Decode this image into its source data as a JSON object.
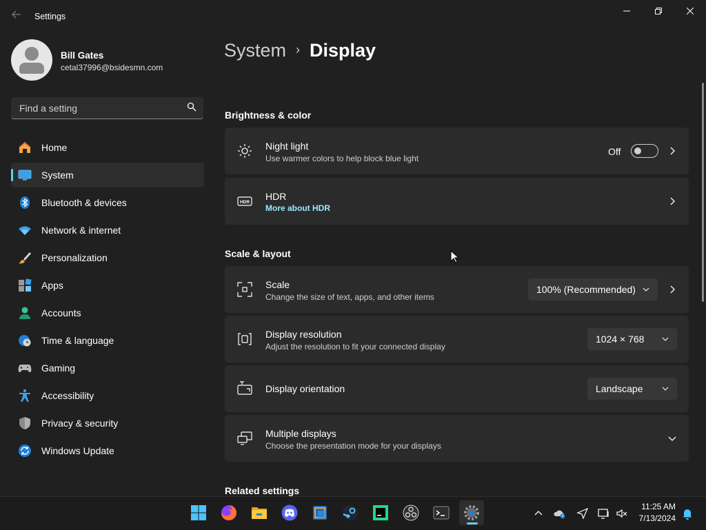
{
  "window": {
    "title": "Settings",
    "minimize": "—",
    "maximize": "❐",
    "close": "✕"
  },
  "user": {
    "name": "Bill Gates",
    "email": "cetal37996@bsidesmn.com"
  },
  "search": {
    "placeholder": "Find a setting"
  },
  "nav": [
    {
      "label": "Home",
      "icon": "home-icon"
    },
    {
      "label": "System",
      "icon": "monitor-icon",
      "active": true
    },
    {
      "label": "Bluetooth & devices",
      "icon": "bluetooth-icon"
    },
    {
      "label": "Network & internet",
      "icon": "wifi-icon"
    },
    {
      "label": "Personalization",
      "icon": "brush-icon"
    },
    {
      "label": "Apps",
      "icon": "apps-icon"
    },
    {
      "label": "Accounts",
      "icon": "person-icon"
    },
    {
      "label": "Time & language",
      "icon": "globe-clock-icon"
    },
    {
      "label": "Gaming",
      "icon": "gamepad-icon"
    },
    {
      "label": "Accessibility",
      "icon": "accessibility-icon"
    },
    {
      "label": "Privacy & security",
      "icon": "shield-icon"
    },
    {
      "label": "Windows Update",
      "icon": "update-icon"
    }
  ],
  "breadcrumb": {
    "parent": "System",
    "separator": "›",
    "current": "Display"
  },
  "sections": {
    "brightness": "Brightness & color",
    "scale": "Scale & layout",
    "related": "Related settings"
  },
  "cards": {
    "night_light": {
      "title": "Night light",
      "desc": "Use warmer colors to help block blue light",
      "state": "Off",
      "on": false
    },
    "hdr": {
      "title": "HDR",
      "link": "More about HDR"
    },
    "scale": {
      "title": "Scale",
      "desc": "Change the size of text, apps, and other items",
      "value": "100% (Recommended)"
    },
    "resolution": {
      "title": "Display resolution",
      "desc": "Adjust the resolution to fit your connected display",
      "value": "1024 × 768"
    },
    "orientation": {
      "title": "Display orientation",
      "value": "Landscape"
    },
    "multiple": {
      "title": "Multiple displays",
      "desc": "Choose the presentation mode for your displays"
    }
  },
  "taskbar": {
    "apps": [
      "start-icon",
      "firefox-icon",
      "file-explorer-icon",
      "discord-icon",
      "virtualbox-icon",
      "steam-icon",
      "pycharm-icon",
      "obs-icon",
      "terminal-icon",
      "settings-icon"
    ],
    "clock": {
      "time": "11:25 AM",
      "date": "7/13/2024"
    }
  },
  "colors": {
    "accent": "#60cdff",
    "link": "#99ebff",
    "background": "#202020",
    "card": "#2b2b2b"
  }
}
